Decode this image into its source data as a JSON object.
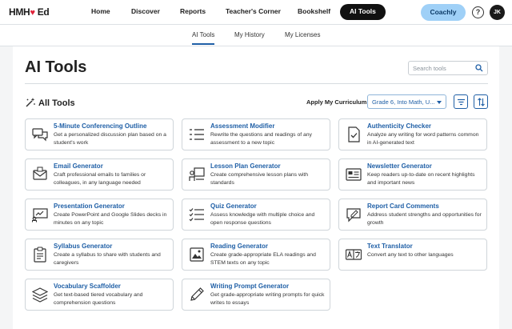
{
  "brand": {
    "logo_text": "HMH",
    "logo_suffix": "Ed"
  },
  "nav": {
    "items": [
      "Home",
      "Discover",
      "Reports",
      "Teacher's Corner",
      "Bookshelf",
      "AI Tools"
    ],
    "coachly": "Coachly",
    "help": "?",
    "avatar": "JK"
  },
  "subnav": {
    "tabs": [
      "AI Tools",
      "My History",
      "My Licenses"
    ]
  },
  "page": {
    "title": "AI Tools",
    "search_placeholder": "Search tools",
    "section_title": "All Tools",
    "apply_label": "Apply My Curriculum",
    "curriculum_value": "Grade 6, Into Math, U..."
  },
  "tools": [
    {
      "title": "5-Minute Conferencing Outline",
      "desc": "Get a personalized discussion plan based on a student's work",
      "icon": "chat-bubbles-icon"
    },
    {
      "title": "Assessment Modifier",
      "desc": "Rewrite the questions and readings of any assessment to a new topic",
      "icon": "list-edit-icon"
    },
    {
      "title": "Authenticity Checker",
      "desc": "Analyze any writing for word patterns common in AI-generated text",
      "icon": "document-check-icon"
    },
    {
      "title": "Email Generator",
      "desc": "Craft professional emails to families or colleagues, in any language needed",
      "icon": "envelope-icon"
    },
    {
      "title": "Lesson Plan Generator",
      "desc": "Create comprehensive lesson plans with standards",
      "icon": "teacher-board-icon"
    },
    {
      "title": "Newsletter Generator",
      "desc": "Keep readers up-to-date on recent highlights and important news",
      "icon": "newspaper-icon"
    },
    {
      "title": "Presentation Generator",
      "desc": "Create PowerPoint and Google Slides decks in minutes on any topic",
      "icon": "presentation-icon"
    },
    {
      "title": "Quiz Generator",
      "desc": "Assess knowledge with multiple choice and open response questions",
      "icon": "checklist-icon"
    },
    {
      "title": "Report Card Comments",
      "desc": "Address student strengths and opportunities for growth",
      "icon": "comment-edit-icon"
    },
    {
      "title": "Syllabus Generator",
      "desc": "Create a syllabus to share with students and caregivers",
      "icon": "clipboard-icon"
    },
    {
      "title": "Reading Generator",
      "desc": "Create grade-appropriate ELA readings and STEM texts on any topic",
      "icon": "image-text-icon"
    },
    {
      "title": "Text Translator",
      "desc": "Convert any text to other languages",
      "icon": "translate-icon"
    },
    {
      "title": "Vocabulary Scaffolder",
      "desc": "Get text-based tiered vocabulary and comprehension questions",
      "icon": "layers-icon"
    },
    {
      "title": "Writing Prompt Generator",
      "desc": "Get grade-appropriate writing prompts for quick writes to essays",
      "icon": "pencil-icon"
    }
  ],
  "colors": {
    "accent": "#1f5fa6",
    "nav_active": "#111111",
    "coachly": "#9fd0f7",
    "brand_heart": "#e0233a"
  }
}
